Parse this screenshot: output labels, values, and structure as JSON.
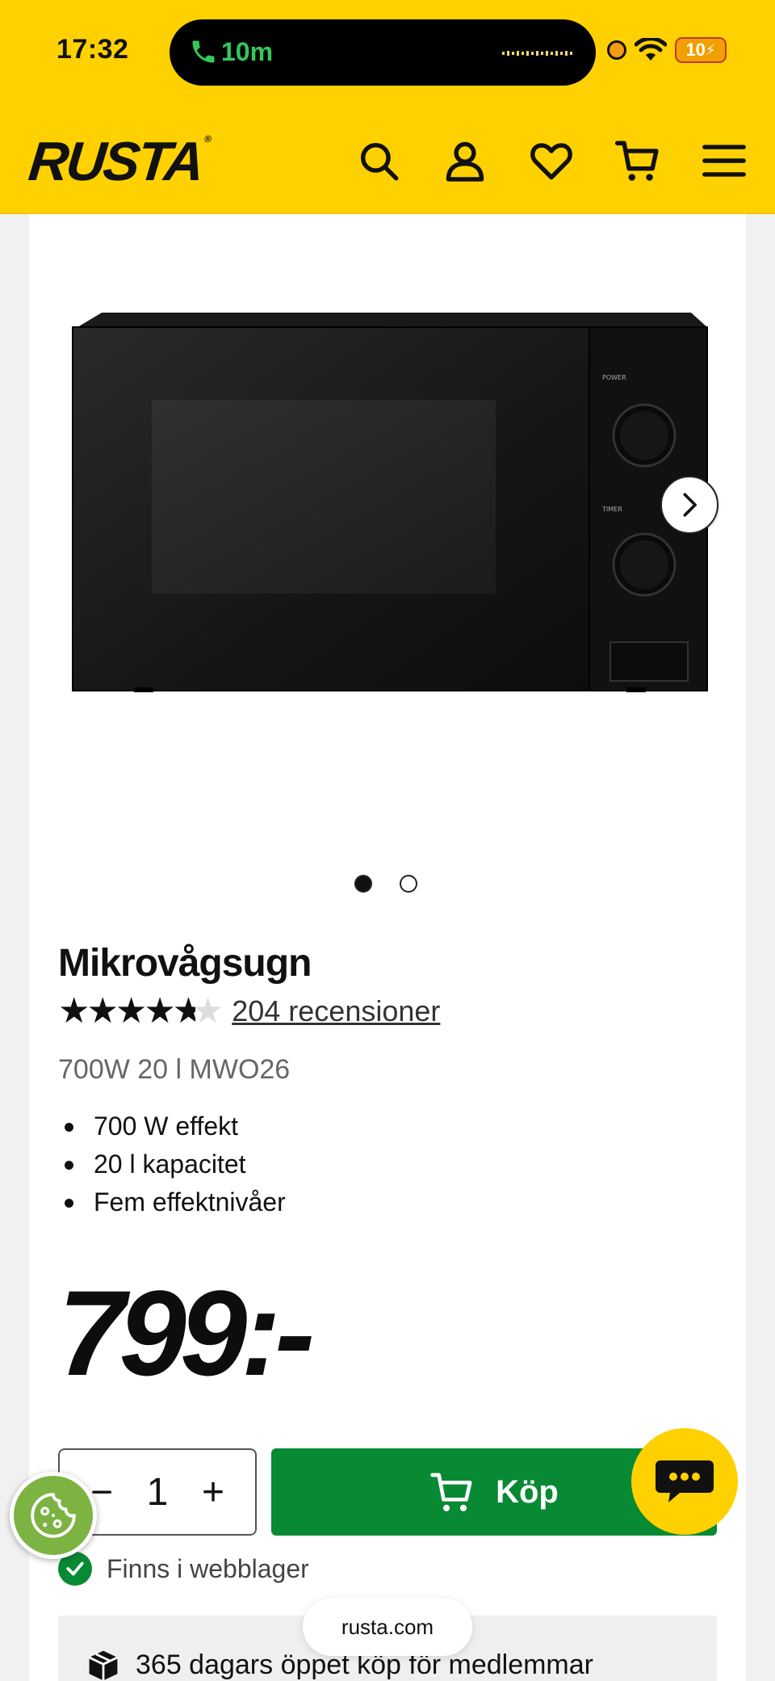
{
  "status_bar": {
    "time": "17:32",
    "call_duration": "10m",
    "battery": "10"
  },
  "header": {
    "logo": "RUSTA",
    "icons": [
      "search-icon",
      "account-icon",
      "heart-icon",
      "cart-icon",
      "menu-icon"
    ]
  },
  "gallery": {
    "image_alt": "microwave-image",
    "current_slide": 1,
    "total_slides": 2
  },
  "product": {
    "title": "Mikrovågsugn",
    "rating": 4.6,
    "reviews": "204 recensioner",
    "subtitle": "700W 20 l MWO26",
    "bullets": [
      "700 W effekt",
      "20 l kapacitet",
      "Fem effektnivåer"
    ],
    "price": "799:-"
  },
  "purchase": {
    "quantity": "1",
    "minus": "−",
    "plus": "+",
    "buy_label": "Köp"
  },
  "stock": {
    "text": "Finns i webblager"
  },
  "perk": {
    "text": "365 dagars öppet köp för medlemmar"
  },
  "browser": {
    "url": "rusta.com"
  },
  "colors": {
    "brand_yellow": "#ffd100",
    "buy_green": "#078a33"
  }
}
